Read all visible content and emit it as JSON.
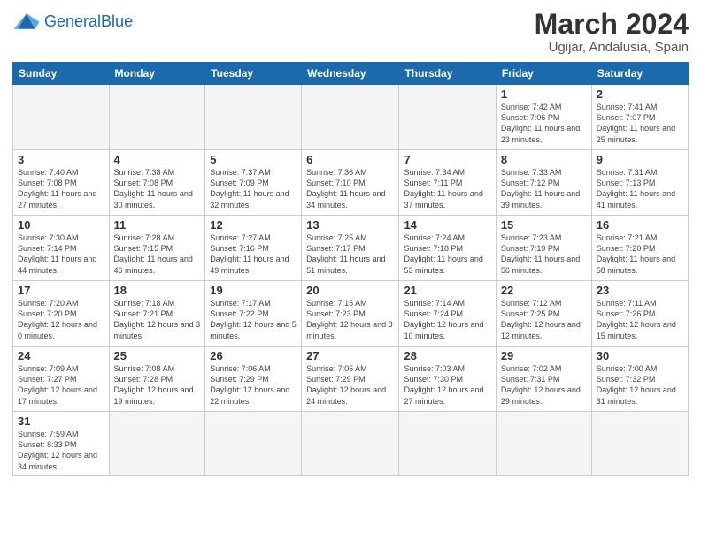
{
  "header": {
    "logo_general": "General",
    "logo_blue": "Blue",
    "month_year": "March 2024",
    "location": "Ugijar, Andalusia, Spain"
  },
  "weekdays": [
    "Sunday",
    "Monday",
    "Tuesday",
    "Wednesday",
    "Thursday",
    "Friday",
    "Saturday"
  ],
  "rows": [
    [
      {
        "day": "",
        "info": ""
      },
      {
        "day": "",
        "info": ""
      },
      {
        "day": "",
        "info": ""
      },
      {
        "day": "",
        "info": ""
      },
      {
        "day": "",
        "info": ""
      },
      {
        "day": "1",
        "info": "Sunrise: 7:42 AM\nSunset: 7:06 PM\nDaylight: 11 hours\nand 23 minutes."
      },
      {
        "day": "2",
        "info": "Sunrise: 7:41 AM\nSunset: 7:07 PM\nDaylight: 11 hours\nand 25 minutes."
      }
    ],
    [
      {
        "day": "3",
        "info": "Sunrise: 7:40 AM\nSunset: 7:08 PM\nDaylight: 11 hours\nand 27 minutes."
      },
      {
        "day": "4",
        "info": "Sunrise: 7:38 AM\nSunset: 7:08 PM\nDaylight: 11 hours\nand 30 minutes."
      },
      {
        "day": "5",
        "info": "Sunrise: 7:37 AM\nSunset: 7:09 PM\nDaylight: 11 hours\nand 32 minutes."
      },
      {
        "day": "6",
        "info": "Sunrise: 7:36 AM\nSunset: 7:10 PM\nDaylight: 11 hours\nand 34 minutes."
      },
      {
        "day": "7",
        "info": "Sunrise: 7:34 AM\nSunset: 7:11 PM\nDaylight: 11 hours\nand 37 minutes."
      },
      {
        "day": "8",
        "info": "Sunrise: 7:33 AM\nSunset: 7:12 PM\nDaylight: 11 hours\nand 39 minutes."
      },
      {
        "day": "9",
        "info": "Sunrise: 7:31 AM\nSunset: 7:13 PM\nDaylight: 11 hours\nand 41 minutes."
      }
    ],
    [
      {
        "day": "10",
        "info": "Sunrise: 7:30 AM\nSunset: 7:14 PM\nDaylight: 11 hours\nand 44 minutes."
      },
      {
        "day": "11",
        "info": "Sunrise: 7:28 AM\nSunset: 7:15 PM\nDaylight: 11 hours\nand 46 minutes."
      },
      {
        "day": "12",
        "info": "Sunrise: 7:27 AM\nSunset: 7:16 PM\nDaylight: 11 hours\nand 49 minutes."
      },
      {
        "day": "13",
        "info": "Sunrise: 7:25 AM\nSunset: 7:17 PM\nDaylight: 11 hours\nand 51 minutes."
      },
      {
        "day": "14",
        "info": "Sunrise: 7:24 AM\nSunset: 7:18 PM\nDaylight: 11 hours\nand 53 minutes."
      },
      {
        "day": "15",
        "info": "Sunrise: 7:23 AM\nSunset: 7:19 PM\nDaylight: 11 hours\nand 56 minutes."
      },
      {
        "day": "16",
        "info": "Sunrise: 7:21 AM\nSunset: 7:20 PM\nDaylight: 11 hours\nand 58 minutes."
      }
    ],
    [
      {
        "day": "17",
        "info": "Sunrise: 7:20 AM\nSunset: 7:20 PM\nDaylight: 12 hours\nand 0 minutes."
      },
      {
        "day": "18",
        "info": "Sunrise: 7:18 AM\nSunset: 7:21 PM\nDaylight: 12 hours\nand 3 minutes."
      },
      {
        "day": "19",
        "info": "Sunrise: 7:17 AM\nSunset: 7:22 PM\nDaylight: 12 hours\nand 5 minutes."
      },
      {
        "day": "20",
        "info": "Sunrise: 7:15 AM\nSunset: 7:23 PM\nDaylight: 12 hours\nand 8 minutes."
      },
      {
        "day": "21",
        "info": "Sunrise: 7:14 AM\nSunset: 7:24 PM\nDaylight: 12 hours\nand 10 minutes."
      },
      {
        "day": "22",
        "info": "Sunrise: 7:12 AM\nSunset: 7:25 PM\nDaylight: 12 hours\nand 12 minutes."
      },
      {
        "day": "23",
        "info": "Sunrise: 7:11 AM\nSunset: 7:26 PM\nDaylight: 12 hours\nand 15 minutes."
      }
    ],
    [
      {
        "day": "24",
        "info": "Sunrise: 7:09 AM\nSunset: 7:27 PM\nDaylight: 12 hours\nand 17 minutes."
      },
      {
        "day": "25",
        "info": "Sunrise: 7:08 AM\nSunset: 7:28 PM\nDaylight: 12 hours\nand 19 minutes."
      },
      {
        "day": "26",
        "info": "Sunrise: 7:06 AM\nSunset: 7:29 PM\nDaylight: 12 hours\nand 22 minutes."
      },
      {
        "day": "27",
        "info": "Sunrise: 7:05 AM\nSunset: 7:29 PM\nDaylight: 12 hours\nand 24 minutes."
      },
      {
        "day": "28",
        "info": "Sunrise: 7:03 AM\nSunset: 7:30 PM\nDaylight: 12 hours\nand 27 minutes."
      },
      {
        "day": "29",
        "info": "Sunrise: 7:02 AM\nSunset: 7:31 PM\nDaylight: 12 hours\nand 29 minutes."
      },
      {
        "day": "30",
        "info": "Sunrise: 7:00 AM\nSunset: 7:32 PM\nDaylight: 12 hours\nand 31 minutes."
      }
    ],
    [
      {
        "day": "31",
        "info": "Sunrise: 7:59 AM\nSunset: 8:33 PM\nDaylight: 12 hours\nand 34 minutes."
      },
      {
        "day": "",
        "info": ""
      },
      {
        "day": "",
        "info": ""
      },
      {
        "day": "",
        "info": ""
      },
      {
        "day": "",
        "info": ""
      },
      {
        "day": "",
        "info": ""
      },
      {
        "day": "",
        "info": ""
      }
    ]
  ]
}
